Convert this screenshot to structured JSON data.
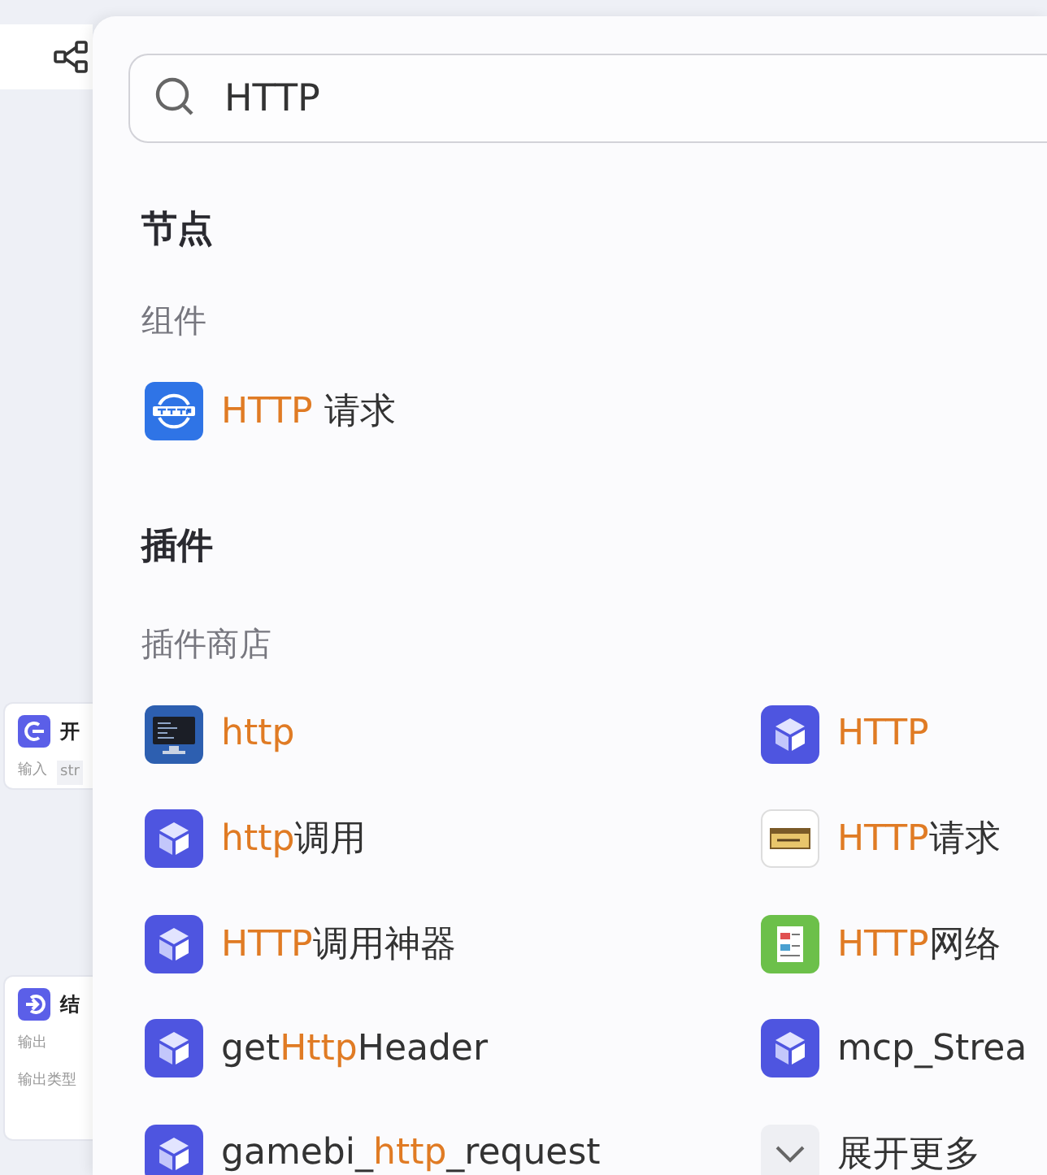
{
  "canvas": {
    "nodes": [
      {
        "kind": "start",
        "title": "开",
        "fields": [
          "输入",
          "str"
        ]
      },
      {
        "kind": "end",
        "title": "结",
        "fields": [
          "输出",
          "输出类型"
        ]
      }
    ]
  },
  "search": {
    "value": "HTTP"
  },
  "sections": [
    {
      "title": "节点",
      "groups": [
        {
          "title": "组件",
          "items": [
            {
              "kind": "http-globe",
              "parts": [
                {
                  "text": "HTTP",
                  "match": true
                },
                {
                  "text": " 请求",
                  "match": false
                }
              ]
            }
          ]
        }
      ]
    },
    {
      "title": "插件",
      "groups": [
        {
          "title": "插件商店",
          "items": [
            {
              "kind": "monitor",
              "parts": [
                {
                  "text": "http",
                  "match": true
                }
              ]
            },
            {
              "kind": "cube",
              "parts": [
                {
                  "text": "HTTP",
                  "match": true
                }
              ]
            },
            {
              "kind": "cube",
              "parts": [
                {
                  "text": "http",
                  "match": true
                },
                {
                  "text": "调用",
                  "match": false
                }
              ]
            },
            {
              "kind": "banner",
              "parts": [
                {
                  "text": "HTTP",
                  "match": true
                },
                {
                  "text": "请求",
                  "match": false
                }
              ]
            },
            {
              "kind": "cube",
              "parts": [
                {
                  "text": "HTTP",
                  "match": true
                },
                {
                  "text": "调用神器",
                  "match": false
                }
              ]
            },
            {
              "kind": "green-doc",
              "parts": [
                {
                  "text": "HTTP",
                  "match": true
                },
                {
                  "text": "网络",
                  "match": false
                }
              ]
            },
            {
              "kind": "cube",
              "parts": [
                {
                  "text": "get",
                  "match": false
                },
                {
                  "text": "Http",
                  "match": true
                },
                {
                  "text": "Header",
                  "match": false
                }
              ]
            },
            {
              "kind": "cube",
              "parts": [
                {
                  "text": "mcp_Strea",
                  "match": false
                }
              ]
            },
            {
              "kind": "cube",
              "parts": [
                {
                  "text": "gamebi_",
                  "match": false
                },
                {
                  "text": "http",
                  "match": true
                },
                {
                  "text": "_request",
                  "match": false
                }
              ]
            },
            {
              "kind": "expand",
              "parts": [
                {
                  "text": "展开更多",
                  "match": false
                }
              ]
            }
          ]
        }
      ]
    }
  ]
}
